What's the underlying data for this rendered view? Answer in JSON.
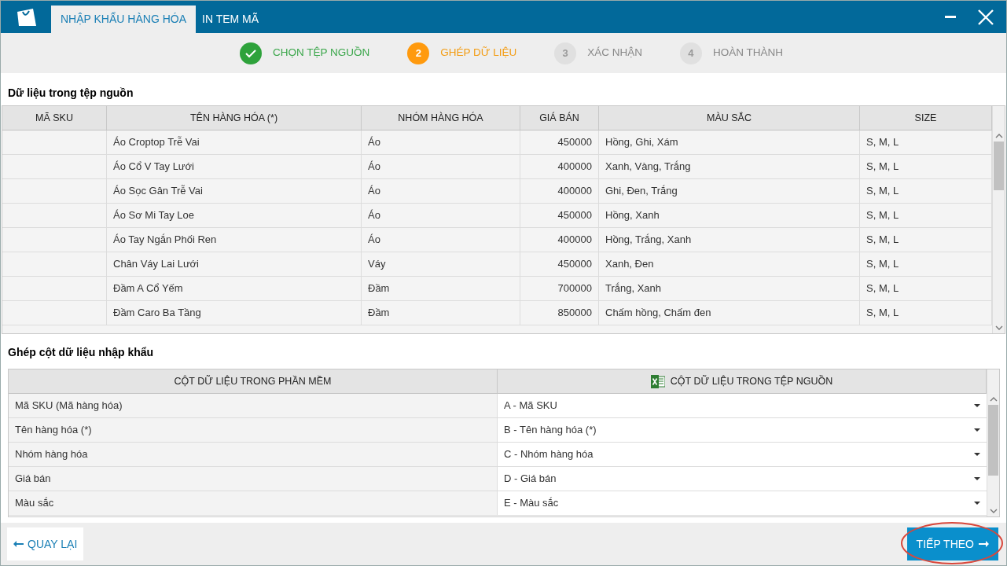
{
  "tabs": [
    {
      "label": "NHẬP KHẨU HÀNG HÓA",
      "selected": true
    },
    {
      "label": "IN TEM MÃ",
      "selected": false
    }
  ],
  "steps": [
    {
      "label": "CHỌN TỆP NGUỒN",
      "completed": true,
      "selected": false
    },
    {
      "number": "2",
      "label": "GHÉP DỮ LIỆU",
      "completed": false,
      "selected": true
    },
    {
      "number": "3",
      "label": "XÁC NHẬN",
      "completed": false,
      "selected": false
    },
    {
      "number": "4",
      "label": "HOÀN THÀNH",
      "completed": false,
      "selected": false
    }
  ],
  "source_section": {
    "title": "Dữ liệu trong tệp nguồn",
    "table": {
      "columns": [
        "MÃ SKU",
        "TÊN HÀNG HÓA (*)",
        "NHÓM HÀNG HÓA",
        "GIÁ BÁN",
        "MÀU SẮC",
        "SIZE"
      ],
      "rows": [
        [
          "",
          "Áo Croptop Trễ Vai",
          "Áo",
          "450000",
          "Hồng, Ghi, Xám",
          "S, M, L"
        ],
        [
          "",
          "Áo Cổ V Tay Lưới",
          "Áo",
          "400000",
          "Xanh, Vàng, Trắng",
          "S, M, L"
        ],
        [
          "",
          "Áo Sọc Gân Trễ Vai",
          "Áo",
          "400000",
          "Ghi, Đen, Trắng",
          "S, M, L"
        ],
        [
          "",
          "Áo Sơ Mi Tay Loe",
          "Áo",
          "450000",
          "Hồng, Xanh",
          "S, M, L"
        ],
        [
          "",
          "Áo Tay Ngắn Phối Ren",
          "Áo",
          "400000",
          "Hồng, Trắng, Xanh",
          "S, M, L"
        ],
        [
          "",
          "Chân Váy Lai Lưới",
          "Váy",
          "450000",
          "Xanh, Đen",
          "S, M, L"
        ],
        [
          "",
          "Đầm A Cổ Yếm",
          "Đầm",
          "700000",
          "Trắng, Xanh",
          "S, M, L"
        ],
        [
          "",
          "Đầm Caro Ba Tầng",
          "Đầm",
          "850000",
          "Chấm hồng, Chấm đen",
          "S, M, L"
        ]
      ]
    }
  },
  "mapping_section": {
    "title": "Ghép cột dữ liệu nhập khẩu",
    "columns": [
      "CỘT DỮ LIỆU TRONG PHẦN MỀM",
      "CỘT DỮ LIỆU TRONG TỆP NGUỒN"
    ],
    "rows": [
      {
        "field": "Mã SKU (Mã hàng hóa)",
        "value": "A - Mã SKU"
      },
      {
        "field": "Tên hàng hóa (*)",
        "value": "B - Tên hàng hóa (*)"
      },
      {
        "field": "Nhóm hàng hóa",
        "value": "C - Nhóm hàng hóa"
      },
      {
        "field": "Giá bán",
        "value": "D - Giá bán"
      },
      {
        "field": "Màu sắc",
        "value": "E - Màu sắc"
      }
    ]
  },
  "footer": {
    "back_button": "QUAY LẠI",
    "next_button": "TIẾP THEO",
    "next_highlighted": true
  }
}
